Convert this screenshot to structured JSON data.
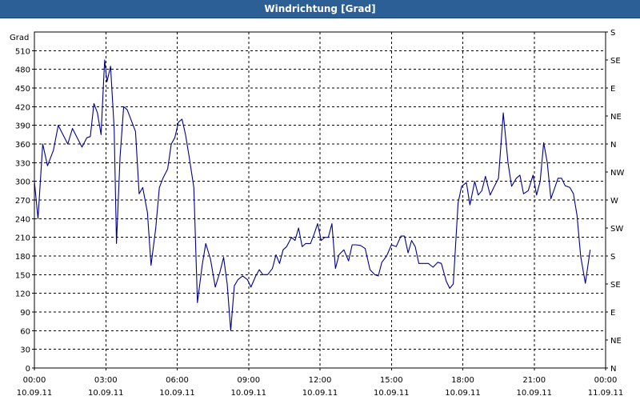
{
  "window": {
    "title": "Windrichtung [Grad]"
  },
  "chart_data": {
    "type": "line",
    "title": "Windrichtung [Grad]",
    "ylabel": "Grad",
    "ylim": [
      0,
      540
    ],
    "grid": true,
    "y_ticks": [
      0,
      30,
      60,
      90,
      120,
      150,
      180,
      210,
      240,
      270,
      300,
      330,
      360,
      390,
      420,
      450,
      480,
      510
    ],
    "right_ticks": [
      {
        "value": 540,
        "label": "S"
      },
      {
        "value": 495,
        "label": "SE"
      },
      {
        "value": 450,
        "label": "E"
      },
      {
        "value": 405,
        "label": "NE"
      },
      {
        "value": 360,
        "label": "N"
      },
      {
        "value": 315,
        "label": "NW"
      },
      {
        "value": 270,
        "label": "W"
      },
      {
        "value": 225,
        "label": "SW"
      },
      {
        "value": 180,
        "label": "S"
      },
      {
        "value": 135,
        "label": "SE"
      },
      {
        "value": 90,
        "label": "E"
      },
      {
        "value": 45,
        "label": "NE"
      },
      {
        "value": 0,
        "label": "N"
      }
    ],
    "xlim": [
      0,
      24
    ],
    "x_ticks": [
      {
        "hour": 0,
        "time": "00:00",
        "date": "10.09.11"
      },
      {
        "hour": 3,
        "time": "03:00",
        "date": "10.09.11"
      },
      {
        "hour": 6,
        "time": "06:00",
        "date": "10.09.11"
      },
      {
        "hour": 9,
        "time": "09:00",
        "date": "10.09.11"
      },
      {
        "hour": 12,
        "time": "12:00",
        "date": "10.09.11"
      },
      {
        "hour": 15,
        "time": "15:00",
        "date": "10.09.11"
      },
      {
        "hour": 18,
        "time": "18:00",
        "date": "10.09.11"
      },
      {
        "hour": 21,
        "time": "21:00",
        "date": "10.09.11"
      },
      {
        "hour": 24,
        "time": "00:00",
        "date": "11.09.11"
      }
    ],
    "series": [
      {
        "color": "#00008b",
        "points": [
          [
            0.0,
            300
          ],
          [
            0.15,
            240
          ],
          [
            0.35,
            360
          ],
          [
            0.55,
            325
          ],
          [
            0.8,
            350
          ],
          [
            1.0,
            390
          ],
          [
            1.2,
            375
          ],
          [
            1.4,
            360
          ],
          [
            1.6,
            385
          ],
          [
            1.8,
            370
          ],
          [
            2.0,
            355
          ],
          [
            2.2,
            370
          ],
          [
            2.35,
            372
          ],
          [
            2.5,
            425
          ],
          [
            2.65,
            410
          ],
          [
            2.8,
            375
          ],
          [
            2.95,
            495
          ],
          [
            3.05,
            460
          ],
          [
            3.2,
            485
          ],
          [
            3.35,
            385
          ],
          [
            3.45,
            200
          ],
          [
            3.6,
            340
          ],
          [
            3.75,
            420
          ],
          [
            3.9,
            415
          ],
          [
            4.1,
            395
          ],
          [
            4.25,
            380
          ],
          [
            4.4,
            280
          ],
          [
            4.55,
            290
          ],
          [
            4.75,
            250
          ],
          [
            4.9,
            165
          ],
          [
            5.1,
            225
          ],
          [
            5.25,
            290
          ],
          [
            5.4,
            305
          ],
          [
            5.6,
            320
          ],
          [
            5.75,
            360
          ],
          [
            5.9,
            370
          ],
          [
            6.05,
            395
          ],
          [
            6.2,
            400
          ],
          [
            6.35,
            375
          ],
          [
            6.5,
            340
          ],
          [
            6.7,
            290
          ],
          [
            6.85,
            105
          ],
          [
            7.05,
            165
          ],
          [
            7.2,
            200
          ],
          [
            7.4,
            175
          ],
          [
            7.6,
            130
          ],
          [
            7.8,
            155
          ],
          [
            7.95,
            178
          ],
          [
            8.1,
            135
          ],
          [
            8.25,
            60
          ],
          [
            8.4,
            132
          ],
          [
            8.55,
            142
          ],
          [
            8.75,
            148
          ],
          [
            8.95,
            142
          ],
          [
            9.1,
            130
          ],
          [
            9.3,
            148
          ],
          [
            9.45,
            158
          ],
          [
            9.6,
            150
          ],
          [
            9.8,
            150
          ],
          [
            10.0,
            160
          ],
          [
            10.15,
            182
          ],
          [
            10.3,
            168
          ],
          [
            10.45,
            190
          ],
          [
            10.6,
            195
          ],
          [
            10.8,
            210
          ],
          [
            10.95,
            205
          ],
          [
            11.1,
            225
          ],
          [
            11.25,
            195
          ],
          [
            11.4,
            200
          ],
          [
            11.6,
            200
          ],
          [
            11.75,
            215
          ],
          [
            11.9,
            232
          ],
          [
            12.05,
            205
          ],
          [
            12.2,
            210
          ],
          [
            12.35,
            210
          ],
          [
            12.5,
            232
          ],
          [
            12.65,
            160
          ],
          [
            12.8,
            182
          ],
          [
            13.0,
            190
          ],
          [
            13.2,
            172
          ],
          [
            13.35,
            198
          ],
          [
            13.5,
            198
          ],
          [
            13.7,
            197
          ],
          [
            13.9,
            192
          ],
          [
            14.1,
            158
          ],
          [
            14.3,
            150
          ],
          [
            14.45,
            148
          ],
          [
            14.6,
            170
          ],
          [
            14.8,
            180
          ],
          [
            15.0,
            198
          ],
          [
            15.2,
            195
          ],
          [
            15.4,
            212
          ],
          [
            15.55,
            212
          ],
          [
            15.7,
            185
          ],
          [
            15.85,
            205
          ],
          [
            16.0,
            195
          ],
          [
            16.15,
            168
          ],
          [
            16.35,
            168
          ],
          [
            16.55,
            168
          ],
          [
            16.75,
            162
          ],
          [
            16.95,
            170
          ],
          [
            17.1,
            168
          ],
          [
            17.3,
            140
          ],
          [
            17.45,
            128
          ],
          [
            17.6,
            135
          ],
          [
            17.8,
            265
          ],
          [
            17.95,
            292
          ],
          [
            18.15,
            298
          ],
          [
            18.3,
            262
          ],
          [
            18.5,
            300
          ],
          [
            18.65,
            278
          ],
          [
            18.8,
            285
          ],
          [
            18.95,
            308
          ],
          [
            19.15,
            278
          ],
          [
            19.3,
            290
          ],
          [
            19.5,
            305
          ],
          [
            19.7,
            410
          ],
          [
            19.9,
            330
          ],
          [
            20.05,
            292
          ],
          [
            20.25,
            305
          ],
          [
            20.4,
            310
          ],
          [
            20.55,
            280
          ],
          [
            20.75,
            285
          ],
          [
            20.95,
            310
          ],
          [
            21.1,
            278
          ],
          [
            21.25,
            300
          ],
          [
            21.4,
            362
          ],
          [
            21.55,
            330
          ],
          [
            21.7,
            272
          ],
          [
            21.85,
            288
          ],
          [
            22.0,
            305
          ],
          [
            22.15,
            305
          ],
          [
            22.3,
            293
          ],
          [
            22.5,
            290
          ],
          [
            22.65,
            280
          ],
          [
            22.8,
            245
          ],
          [
            22.95,
            180
          ],
          [
            23.15,
            136
          ],
          [
            23.35,
            190
          ]
        ]
      }
    ]
  }
}
